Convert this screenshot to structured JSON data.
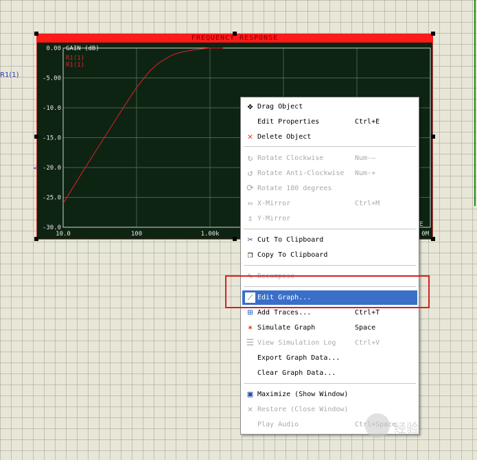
{
  "canvas": {
    "left_label": "R1(1)",
    "pin_mark": "<",
    "watermark_text": "经验"
  },
  "graph": {
    "title": "FREQUENCY RESPONSE",
    "y_axis_title": "GAIN (dB)",
    "legend": [
      "R1(1)",
      "R1(1)"
    ],
    "trace_color": "#e0202a",
    "y_ticks": [
      "0.00",
      "-5.00",
      "-10.0",
      "-15.0",
      "-20.0",
      "-25.0",
      "-30.0"
    ],
    "x_ticks": [
      "10.0",
      "100",
      "1.00k",
      "0M"
    ],
    "right_edge_label": "E"
  },
  "chart_data": {
    "type": "line",
    "title": "FREQUENCY RESPONSE",
    "ylabel": "GAIN (dB)",
    "xlabel": "",
    "x_scale": "log",
    "xlim": [
      10,
      1000000
    ],
    "ylim": [
      -30,
      0
    ],
    "grid": true,
    "series": [
      {
        "name": "R1(1)",
        "x": [
          10,
          15,
          20,
          30,
          50,
          70,
          100,
          150,
          200,
          300,
          400,
          600,
          800,
          1000,
          1500
        ],
        "y": [
          -26,
          -22.5,
          -20,
          -16.6,
          -12.3,
          -9.5,
          -6.6,
          -3.9,
          -2.5,
          -1.2,
          -0.7,
          -0.3,
          -0.1,
          0,
          0
        ]
      }
    ]
  },
  "menu": {
    "items": [
      {
        "label": "Drag Object",
        "shortcut": "",
        "icon": "move-icon"
      },
      {
        "label": "Edit Properties",
        "shortcut": "Ctrl+E",
        "icon": ""
      },
      {
        "label": "Delete Object",
        "shortcut": "",
        "icon": "delete-x-icon"
      },
      {
        "label": "Rotate Clockwise",
        "shortcut": "Num-—",
        "icon": "rotate-cw-icon"
      },
      {
        "label": "Rotate Anti-Clockwise",
        "shortcut": "Num-+",
        "icon": "rotate-ccw-icon"
      },
      {
        "label": "Rotate 180 degrees",
        "shortcut": "",
        "icon": "rotate-180-icon"
      },
      {
        "label": "X-Mirror",
        "shortcut": "Ctrl+M",
        "icon": "x-mirror-icon"
      },
      {
        "label": "Y-Mirror",
        "shortcut": "",
        "icon": "y-mirror-icon"
      },
      {
        "label": "Cut To Clipboard",
        "shortcut": "",
        "icon": "scissors-icon"
      },
      {
        "label": "Copy To Clipboard",
        "shortcut": "",
        "icon": "copy-icon"
      },
      {
        "label": "Decompose",
        "shortcut": "",
        "icon": "decompose-icon"
      },
      {
        "label": "Edit Graph...",
        "shortcut": "",
        "icon": "edit-graph-icon"
      },
      {
        "label": "Add Traces...",
        "shortcut": "Ctrl+T",
        "icon": "add-traces-icon"
      },
      {
        "label": "Simulate Graph",
        "shortcut": "Space",
        "icon": "simulate-icon"
      },
      {
        "label": "View Simulation Log",
        "shortcut": "Ctrl+V",
        "icon": "log-icon"
      },
      {
        "label": "Export Graph Data...",
        "shortcut": "",
        "icon": ""
      },
      {
        "label": "Clear Graph Data...",
        "shortcut": "",
        "icon": ""
      },
      {
        "label": "Maximize (Show Window)",
        "shortcut": "",
        "icon": "maximize-icon"
      },
      {
        "label": "Restore (Close Window)",
        "shortcut": "",
        "icon": "restore-x-icon"
      },
      {
        "label": "Play Audio",
        "shortcut": "Ctrl+Space",
        "icon": ""
      }
    ]
  }
}
